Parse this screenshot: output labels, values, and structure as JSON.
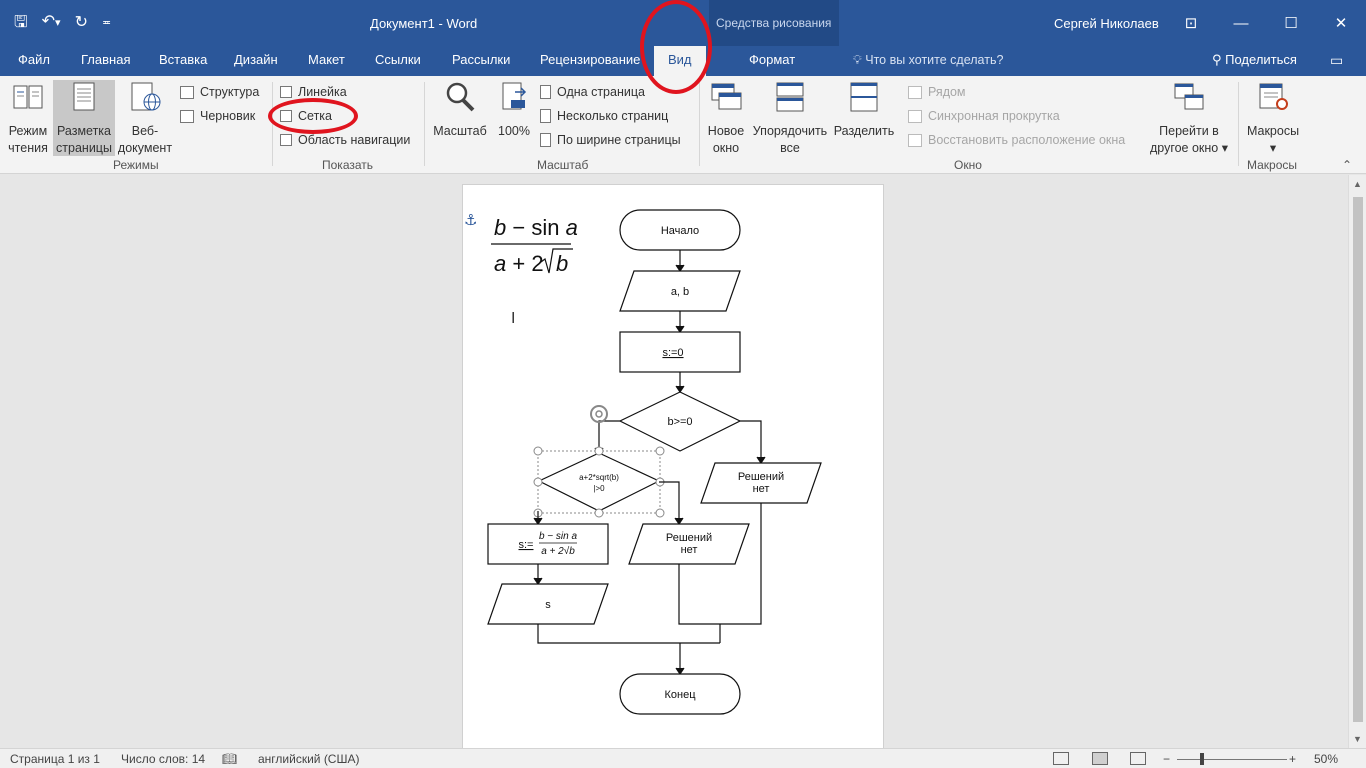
{
  "titlebar": {
    "qat_save": "🖫",
    "qat_undo": "↶",
    "qat_undo_arrow": "▾",
    "qat_redo": "↻",
    "qat_customize": "≖",
    "document_title": "Документ1  -  Word",
    "contextual_group": "Средства рисования",
    "user_name": "Сергей Николаев",
    "ribbon_options": "⊡",
    "minimize": "—",
    "maximize": "☐",
    "close": "✕"
  },
  "tabs": {
    "file": "Файл",
    "home": "Главная",
    "insert": "Вставка",
    "design": "Дизайн",
    "layout": "Макет",
    "references": "Ссылки",
    "mailings": "Рассылки",
    "review": "Рецензирование",
    "view": "Вид",
    "format": "Формат",
    "tell_me": "Что вы хотите сделать?",
    "share": "Поделиться"
  },
  "ribbon": {
    "views": {
      "read_mode": [
        "Режим",
        "чтения"
      ],
      "print_layout": [
        "Разметка",
        "страницы"
      ],
      "web_layout": [
        "Веб-",
        "документ"
      ],
      "outline": "Структура",
      "draft": "Черновик",
      "label": "Режимы"
    },
    "show": {
      "ruler": "Линейка",
      "gridlines": "Сетка",
      "nav_pane": "Область навигации",
      "label": "Показать"
    },
    "zoom": {
      "zoom": "Масштаб",
      "hundred": "100%",
      "one_page": "Одна страница",
      "multiple_pages": "Несколько страниц",
      "page_width": "По ширине страницы",
      "label": "Масштаб"
    },
    "window": {
      "new_window": [
        "Новое",
        "окно"
      ],
      "arrange_all": [
        "Упорядочить",
        "все"
      ],
      "split": "Разделить",
      "side_by_side": "Рядом",
      "sync_scroll": "Синхронная прокрутка",
      "reset_position": "Восстановить расположение окна",
      "switch_windows": [
        "Перейти в",
        "другое окно"
      ],
      "label": "Окно"
    },
    "macros": {
      "macros": "Макросы",
      "label": "Макросы"
    },
    "collapse": "⌃"
  },
  "document": {
    "formula": {
      "numerator_b": "b",
      "numerator_rest": "− sin ",
      "numerator_a": "a",
      "denominator_a": "a",
      "denominator_rest": " + 2",
      "denominator_b": "b"
    },
    "flowchart": {
      "start": "Начало",
      "input": "a, b",
      "assign": "s:=0",
      "cond1": "b>=0",
      "cond2_line1": "a+2*sqrt(b)",
      "cond2_line2": "|>0",
      "no_solution": [
        "Решений",
        "нет"
      ],
      "compute_prefix": "s:=",
      "compute_num": "b − sin a",
      "compute_den": "a + 2√b",
      "output": "s",
      "end": "Конец"
    }
  },
  "statusbar": {
    "page": "Страница 1 из 1",
    "words": "Число слов: 14",
    "language": "английский (США)",
    "zoom": "50%",
    "zoom_minus": "−",
    "zoom_plus": "+"
  },
  "colors": {
    "accent": "#2b579a",
    "highlight": "#e0141e"
  }
}
